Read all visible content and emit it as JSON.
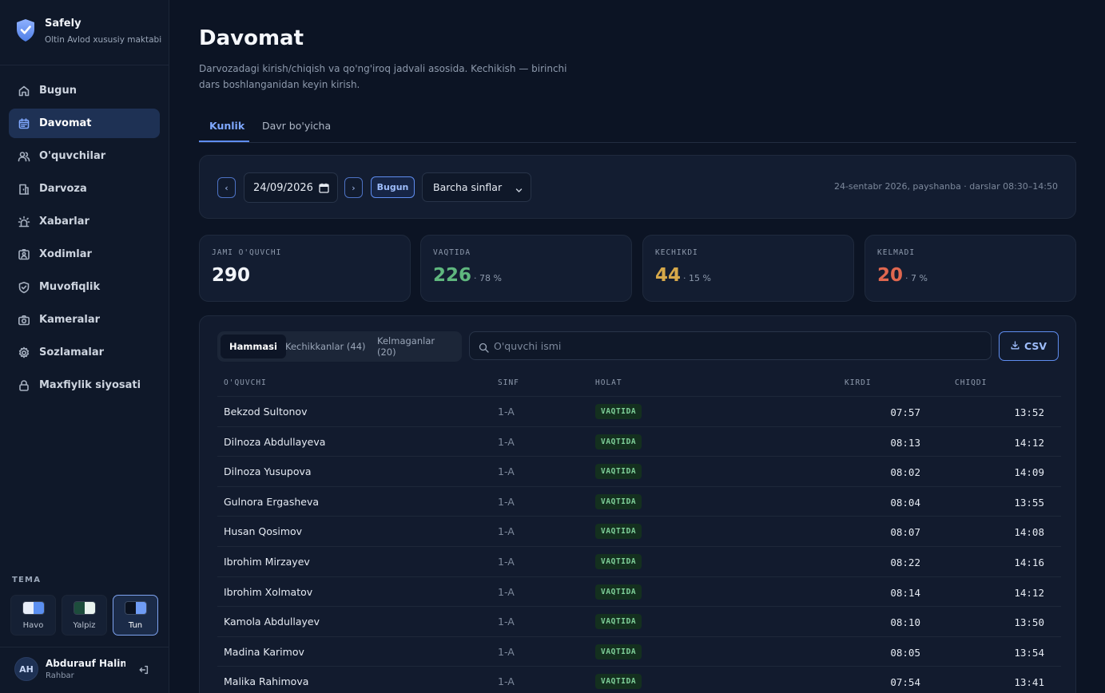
{
  "brand": {
    "name": "Safely",
    "subtitle": "Oltin Avlod xususiy maktabi"
  },
  "sidebar": {
    "items": [
      {
        "label": "Bugun",
        "icon": "home-icon"
      },
      {
        "label": "Davomat",
        "icon": "calendar-icon",
        "active": true
      },
      {
        "label": "O'quvchilar",
        "icon": "users-icon"
      },
      {
        "label": "Darvoza",
        "icon": "gate-icon"
      },
      {
        "label": "Xabarlar",
        "icon": "alarm-icon"
      },
      {
        "label": "Xodimlar",
        "icon": "id-card-icon"
      },
      {
        "label": "Muvofiqlik",
        "icon": "shield-check-icon"
      },
      {
        "label": "Kameralar",
        "icon": "camera-icon"
      },
      {
        "label": "Sozlamalar",
        "icon": "gear-icon"
      },
      {
        "label": "Maxfiylik siyosati",
        "icon": "lock-icon"
      }
    ],
    "theme_label": "TEMA",
    "themes": [
      {
        "label": "Havo",
        "colors": [
          "#e8eef9",
          "#5b8ff0"
        ]
      },
      {
        "label": "Yalpiz",
        "colors": [
          "#1d4d3c",
          "#e9f3ee"
        ]
      },
      {
        "label": "Tun",
        "colors": [
          "#0b1220",
          "#6f9cf5"
        ],
        "active": true
      }
    ],
    "user": {
      "initials": "AH",
      "name": "Abdurauf Halimov",
      "name_display": "Abdurauf Halim...",
      "role": "Rahbar"
    }
  },
  "page": {
    "title": "Davomat",
    "description": "Darvozadagi kirish/chiqish va qo'ng'iroq jadvali asosida. Kechikish — birinchi dars boshlanganidan keyin kirish.",
    "tabs": [
      "Kunlik",
      "Davr bo'yicha"
    ]
  },
  "toolbar": {
    "prev": "‹",
    "next": "›",
    "date": "24/09/2026",
    "today_label": "Bugun",
    "class_select": "Barcha sinflar",
    "info": "24-sentabr 2026, payshanba · darslar 08:30–14:50"
  },
  "stats": [
    {
      "label": "JAMI O'QUVCHI",
      "value": "290",
      "pct": "",
      "color": "#f1f4f9"
    },
    {
      "label": "VAQTIDA",
      "value": "226",
      "pct": "· 78 %",
      "color": "#5fb77e"
    },
    {
      "label": "KECHIKDI",
      "value": "44",
      "pct": "· 15 %",
      "color": "#d6a84a"
    },
    {
      "label": "KELMADI",
      "value": "20",
      "pct": "· 7 %",
      "color": "#e0674f"
    }
  ],
  "filters": [
    "Hammasi",
    "Kechikkanlar (44)",
    "Kelmaganlar (20)"
  ],
  "search": {
    "placeholder": "O'quvchi ismi"
  },
  "csv_label": "CSV",
  "table": {
    "headers": [
      "O'QUVCHI",
      "SINF",
      "HOLAT",
      "KIRDI",
      "CHIQDI"
    ],
    "rows": [
      {
        "name": "Bekzod Sultonov",
        "class": "1-A",
        "status": "VAQTIDA",
        "in": "07:57",
        "out": "13:52"
      },
      {
        "name": "Dilnoza Abdullayeva",
        "class": "1-A",
        "status": "VAQTIDA",
        "in": "08:13",
        "out": "14:12"
      },
      {
        "name": "Dilnoza Yusupova",
        "class": "1-A",
        "status": "VAQTIDA",
        "in": "08:02",
        "out": "14:09"
      },
      {
        "name": "Gulnora Ergasheva",
        "class": "1-A",
        "status": "VAQTIDA",
        "in": "08:04",
        "out": "13:55"
      },
      {
        "name": "Husan Qosimov",
        "class": "1-A",
        "status": "VAQTIDA",
        "in": "08:07",
        "out": "14:08"
      },
      {
        "name": "Ibrohim Mirzayev",
        "class": "1-A",
        "status": "VAQTIDA",
        "in": "08:22",
        "out": "14:16"
      },
      {
        "name": "Ibrohim Xolmatov",
        "class": "1-A",
        "status": "VAQTIDA",
        "in": "08:14",
        "out": "14:12"
      },
      {
        "name": "Kamola Abdullayev",
        "class": "1-A",
        "status": "VAQTIDA",
        "in": "08:10",
        "out": "13:50"
      },
      {
        "name": "Madina Karimov",
        "class": "1-A",
        "status": "VAQTIDA",
        "in": "08:05",
        "out": "13:54"
      },
      {
        "name": "Malika Rahimova",
        "class": "1-A",
        "status": "VAQTIDA",
        "in": "07:54",
        "out": "13:41"
      }
    ]
  }
}
